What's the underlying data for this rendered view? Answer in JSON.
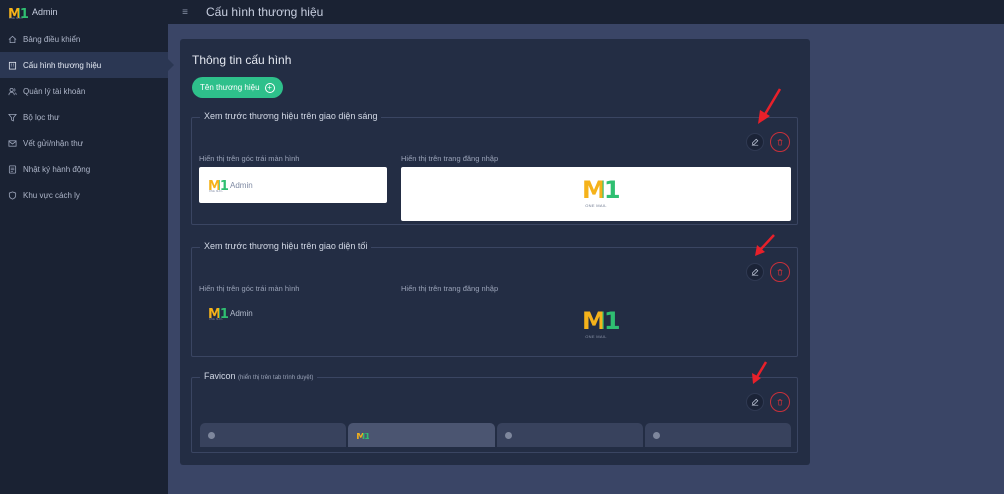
{
  "app": {
    "brand_label": "Admin",
    "logo_text": "M1",
    "logo_sub_small": "ONE MAIL",
    "page_title": "Cấu hình thương hiệu"
  },
  "sidebar": {
    "items": [
      {
        "label": "Bảng điều khiển",
        "icon": "home-icon",
        "active": false
      },
      {
        "label": "Cấu hình thương hiệu",
        "icon": "building-icon",
        "active": true
      },
      {
        "label": "Quản lý tài khoản",
        "icon": "users-icon",
        "active": false
      },
      {
        "label": "Bộ lọc thư",
        "icon": "filter-icon",
        "active": false
      },
      {
        "label": "Vết gửi/nhận thư",
        "icon": "mail-icon",
        "active": false
      },
      {
        "label": "Nhật ký hành động",
        "icon": "log-icon",
        "active": false
      },
      {
        "label": "Khu vực cách ly",
        "icon": "shield-icon",
        "active": false
      }
    ]
  },
  "card": {
    "title": "Thông tin cấu hình",
    "add_button_label": "Tên thương hiệu"
  },
  "sections": {
    "light": {
      "title": "Xem trước thương hiệu trên giao diện sáng",
      "left_label": "Hiển thị trên góc trái màn hình",
      "right_label": "Hiển thị trên trang đăng nhập",
      "admin_text": "Admin",
      "logo_caption": "ONE MAIL"
    },
    "dark": {
      "title": "Xem trước thương hiệu trên giao diện tối",
      "left_label": "Hiển thị trên góc trái màn hình",
      "right_label": "Hiển thị trên trang đăng nhập",
      "admin_text": "Admin",
      "logo_caption": "ONE MAIL"
    },
    "favicon": {
      "title": "Favicon",
      "subtitle": "(hiển thị trên tab trình duyệt)",
      "tab_count": 4,
      "active_tab_index": 1
    }
  },
  "colors": {
    "accent": "#2ec08b",
    "logo_orange": "#f5b21a",
    "logo_green": "#2fbf71",
    "danger": "#c9303a",
    "annotation_arrow": "#e8202a"
  }
}
